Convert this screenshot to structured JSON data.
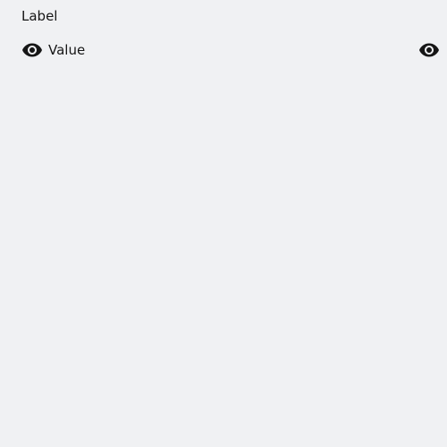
{
  "field": {
    "label": "Label",
    "value": "Value",
    "leading_icon": "eye-icon",
    "trailing_icon": "eye-icon"
  },
  "colors": {
    "background": "#f0f1f3",
    "text": "#161616",
    "icon": "#161616"
  }
}
